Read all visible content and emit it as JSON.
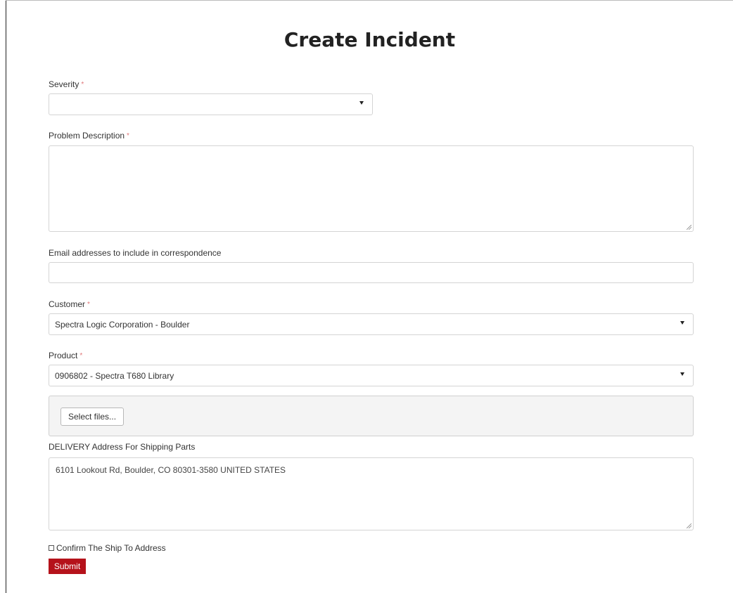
{
  "page": {
    "title": "Create Incident"
  },
  "severity": {
    "label": "Severity",
    "required_marker": "*",
    "value": ""
  },
  "problem_description": {
    "label": "Problem Description",
    "required_marker": "*",
    "value": ""
  },
  "email": {
    "label": "Email addresses to include in correspondence",
    "value": ""
  },
  "customer": {
    "label": "Customer",
    "required_marker": "*",
    "value": "Spectra Logic Corporation - Boulder"
  },
  "product": {
    "label": "Product",
    "required_marker": "*",
    "value": "0906802 - Spectra T680 Library"
  },
  "attachments": {
    "button_label": "Select files..."
  },
  "delivery_address": {
    "label": "DELIVERY Address For Shipping Parts",
    "value": "6101 Lookout Rd, Boulder, CO 80301-3580 UNITED STATES"
  },
  "confirm": {
    "label": "Confirm The Ship To Address",
    "checked": false
  },
  "submit": {
    "label": "Submit"
  },
  "colors": {
    "submit_bg": "#b5121b",
    "required_marker": "#e0787a",
    "attachment_bg": "#f4f4f4"
  },
  "icons": {
    "dropdown": "caret-down-icon",
    "resize": "resize-grip-icon"
  }
}
